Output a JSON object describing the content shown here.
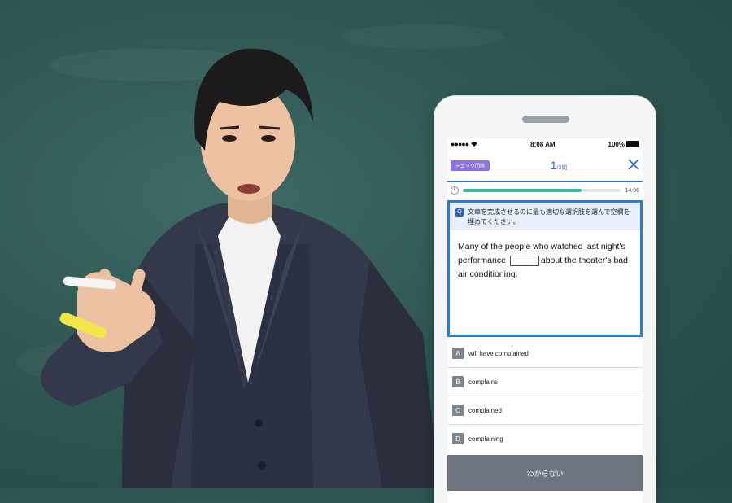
{
  "status_bar": {
    "signal": "●●●●●",
    "time": "8:08 AM",
    "battery_percent": "100%"
  },
  "quiz": {
    "badge": "チェック問題",
    "current": "1",
    "total": "/3問",
    "close_icon": "close-icon",
    "timer": "14:96",
    "progress_fraction": 0.75,
    "instruction": "文章を完成させるのに最も適切な選択肢を選んで空欄を埋めてください。",
    "question_before": "Many of the people who watched last night's performance",
    "question_after": "about the theater's bad air conditioning.",
    "choices": [
      {
        "letter": "A",
        "text": "will have complained"
      },
      {
        "letter": "B",
        "text": "complains"
      },
      {
        "letter": "C",
        "text": "complained"
      },
      {
        "letter": "D",
        "text": "complaining"
      }
    ],
    "dont_know": "わからない"
  },
  "colors": {
    "board": "#2f5753",
    "accent_blue": "#2e6fcf",
    "badge_purple": "#8b74e0",
    "progress_teal": "#42b5a3",
    "choice_letter_gray": "#7c858f"
  }
}
